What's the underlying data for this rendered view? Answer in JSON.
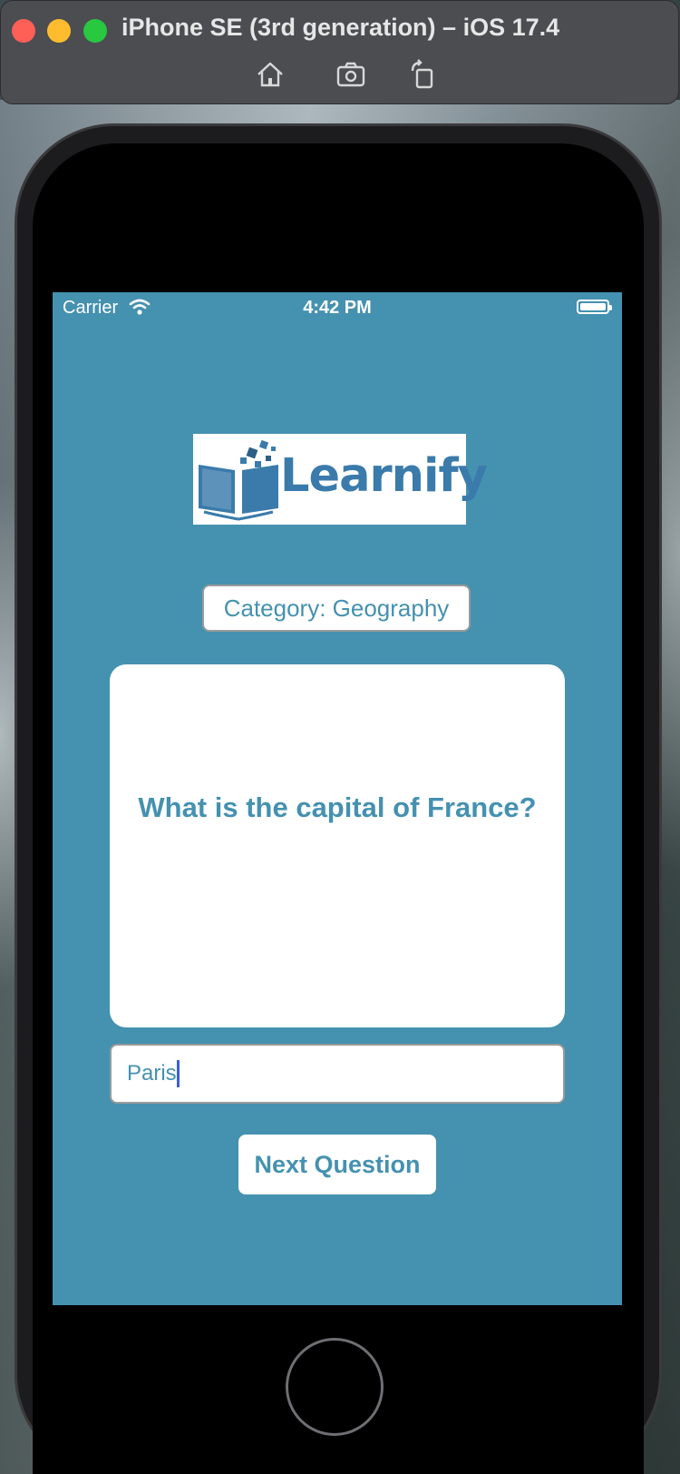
{
  "simulator": {
    "title": "iPhone SE (3rd generation) – iOS 17.4",
    "toolbar": [
      "home-icon",
      "screenshot-icon",
      "rotate-icon"
    ]
  },
  "status_bar": {
    "carrier": "Carrier",
    "time": "4:42 PM",
    "battery_level": 1.0
  },
  "app": {
    "logo_text": "Learnify",
    "category_label": "Category: Geography",
    "question": "What is the capital of France?",
    "answer_value": "Paris",
    "next_button_label": "Next Question"
  },
  "colors": {
    "screen_background": "#4591b0",
    "accent": "#4591b0",
    "logo_blue": "#3a7bab",
    "cursor": "#3c5de0"
  }
}
